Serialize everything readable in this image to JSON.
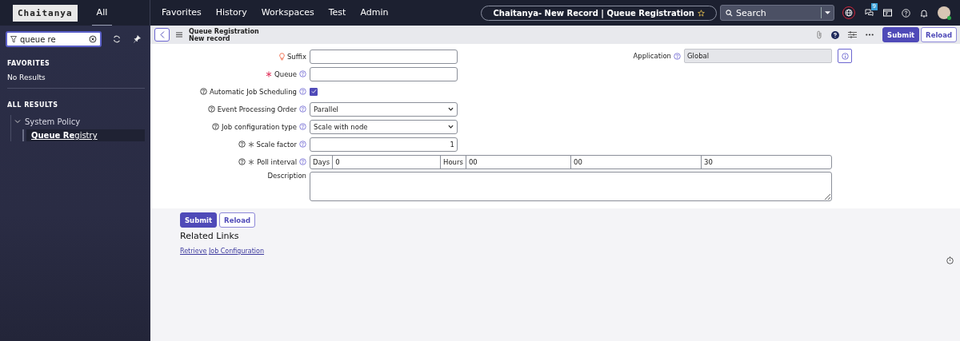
{
  "topbar": {
    "logo": "Chaitanya",
    "nav": [
      {
        "label": "All",
        "selected": true
      },
      {
        "label": "Favorites",
        "selected": false
      },
      {
        "label": "History",
        "selected": false
      },
      {
        "label": "Workspaces",
        "selected": false
      },
      {
        "label": "Test",
        "selected": false
      },
      {
        "label": "Admin",
        "selected": false
      }
    ],
    "title": "Chaitanya- New Record | Queue Registration",
    "search": {
      "placeholder": "Search"
    },
    "chat_badge": "9"
  },
  "sidebar": {
    "filter": {
      "value": "queue re"
    },
    "sections": [
      {
        "heading": "FAVORITES",
        "empty_text": "No Results"
      },
      {
        "heading": "ALL RESULTS",
        "tree": [
          {
            "label": "System Policy",
            "expanded": true,
            "children": [
              {
                "label": "**Queue Re**gistry",
                "selected": true
              }
            ]
          }
        ]
      }
    ]
  },
  "header": {
    "title": "Queue Registration",
    "subtitle": "New record",
    "buttons": [
      {
        "label": "Submit",
        "kind": "primary"
      },
      {
        "label": "Reload",
        "kind": "secondary"
      }
    ]
  },
  "form": {
    "fields": [
      {
        "label": "Suffix",
        "kind": "text",
        "suggestion": true,
        "mandatory": false,
        "help_before": false,
        "help_after": false
      },
      {
        "label": "Queue",
        "kind": "text",
        "suggestion": false,
        "mandatory": true,
        "help_before": false,
        "help_after": true
      },
      {
        "label": "Automatic Job Scheduling",
        "kind": "checkbox",
        "checked": true,
        "suggestion": false,
        "mandatory": false,
        "help_before": true,
        "help_after": true
      },
      {
        "label": "Event Processing Order",
        "kind": "select",
        "value": "Parallel",
        "suggestion": false,
        "mandatory": false,
        "help_before": true,
        "help_after": true
      },
      {
        "label": "Job configuration type",
        "kind": "select",
        "value": "Scale with node",
        "suggestion": false,
        "mandatory": false,
        "help_before": true,
        "help_after": true
      },
      {
        "label": "Scale factor",
        "kind": "number",
        "value": "1",
        "suggestion": false,
        "mandatory": true,
        "help_before": true,
        "help_after": true
      },
      {
        "label": "Poll interval",
        "kind": "duration",
        "parts": [
          {
            "label": "Days",
            "value": "0"
          },
          {
            "label": "Hours",
            "value": "00"
          },
          {
            "value": "00"
          },
          {
            "value": "30"
          }
        ],
        "suggestion": false,
        "mandatory": true,
        "help_before": true,
        "help_after": true
      },
      {
        "label": "Description",
        "kind": "textarea",
        "suggestion": false,
        "mandatory": false,
        "help_before": false,
        "help_after": false
      }
    ],
    "application": {
      "label": "Application",
      "value": "Global"
    }
  },
  "bottom": {
    "buttons": [
      {
        "label": "Submit",
        "kind": "primary"
      },
      {
        "label": "Reload",
        "kind": "secondary"
      }
    ],
    "related_heading": "Related Links",
    "links": [
      "Retrieve Job Configuration"
    ]
  }
}
